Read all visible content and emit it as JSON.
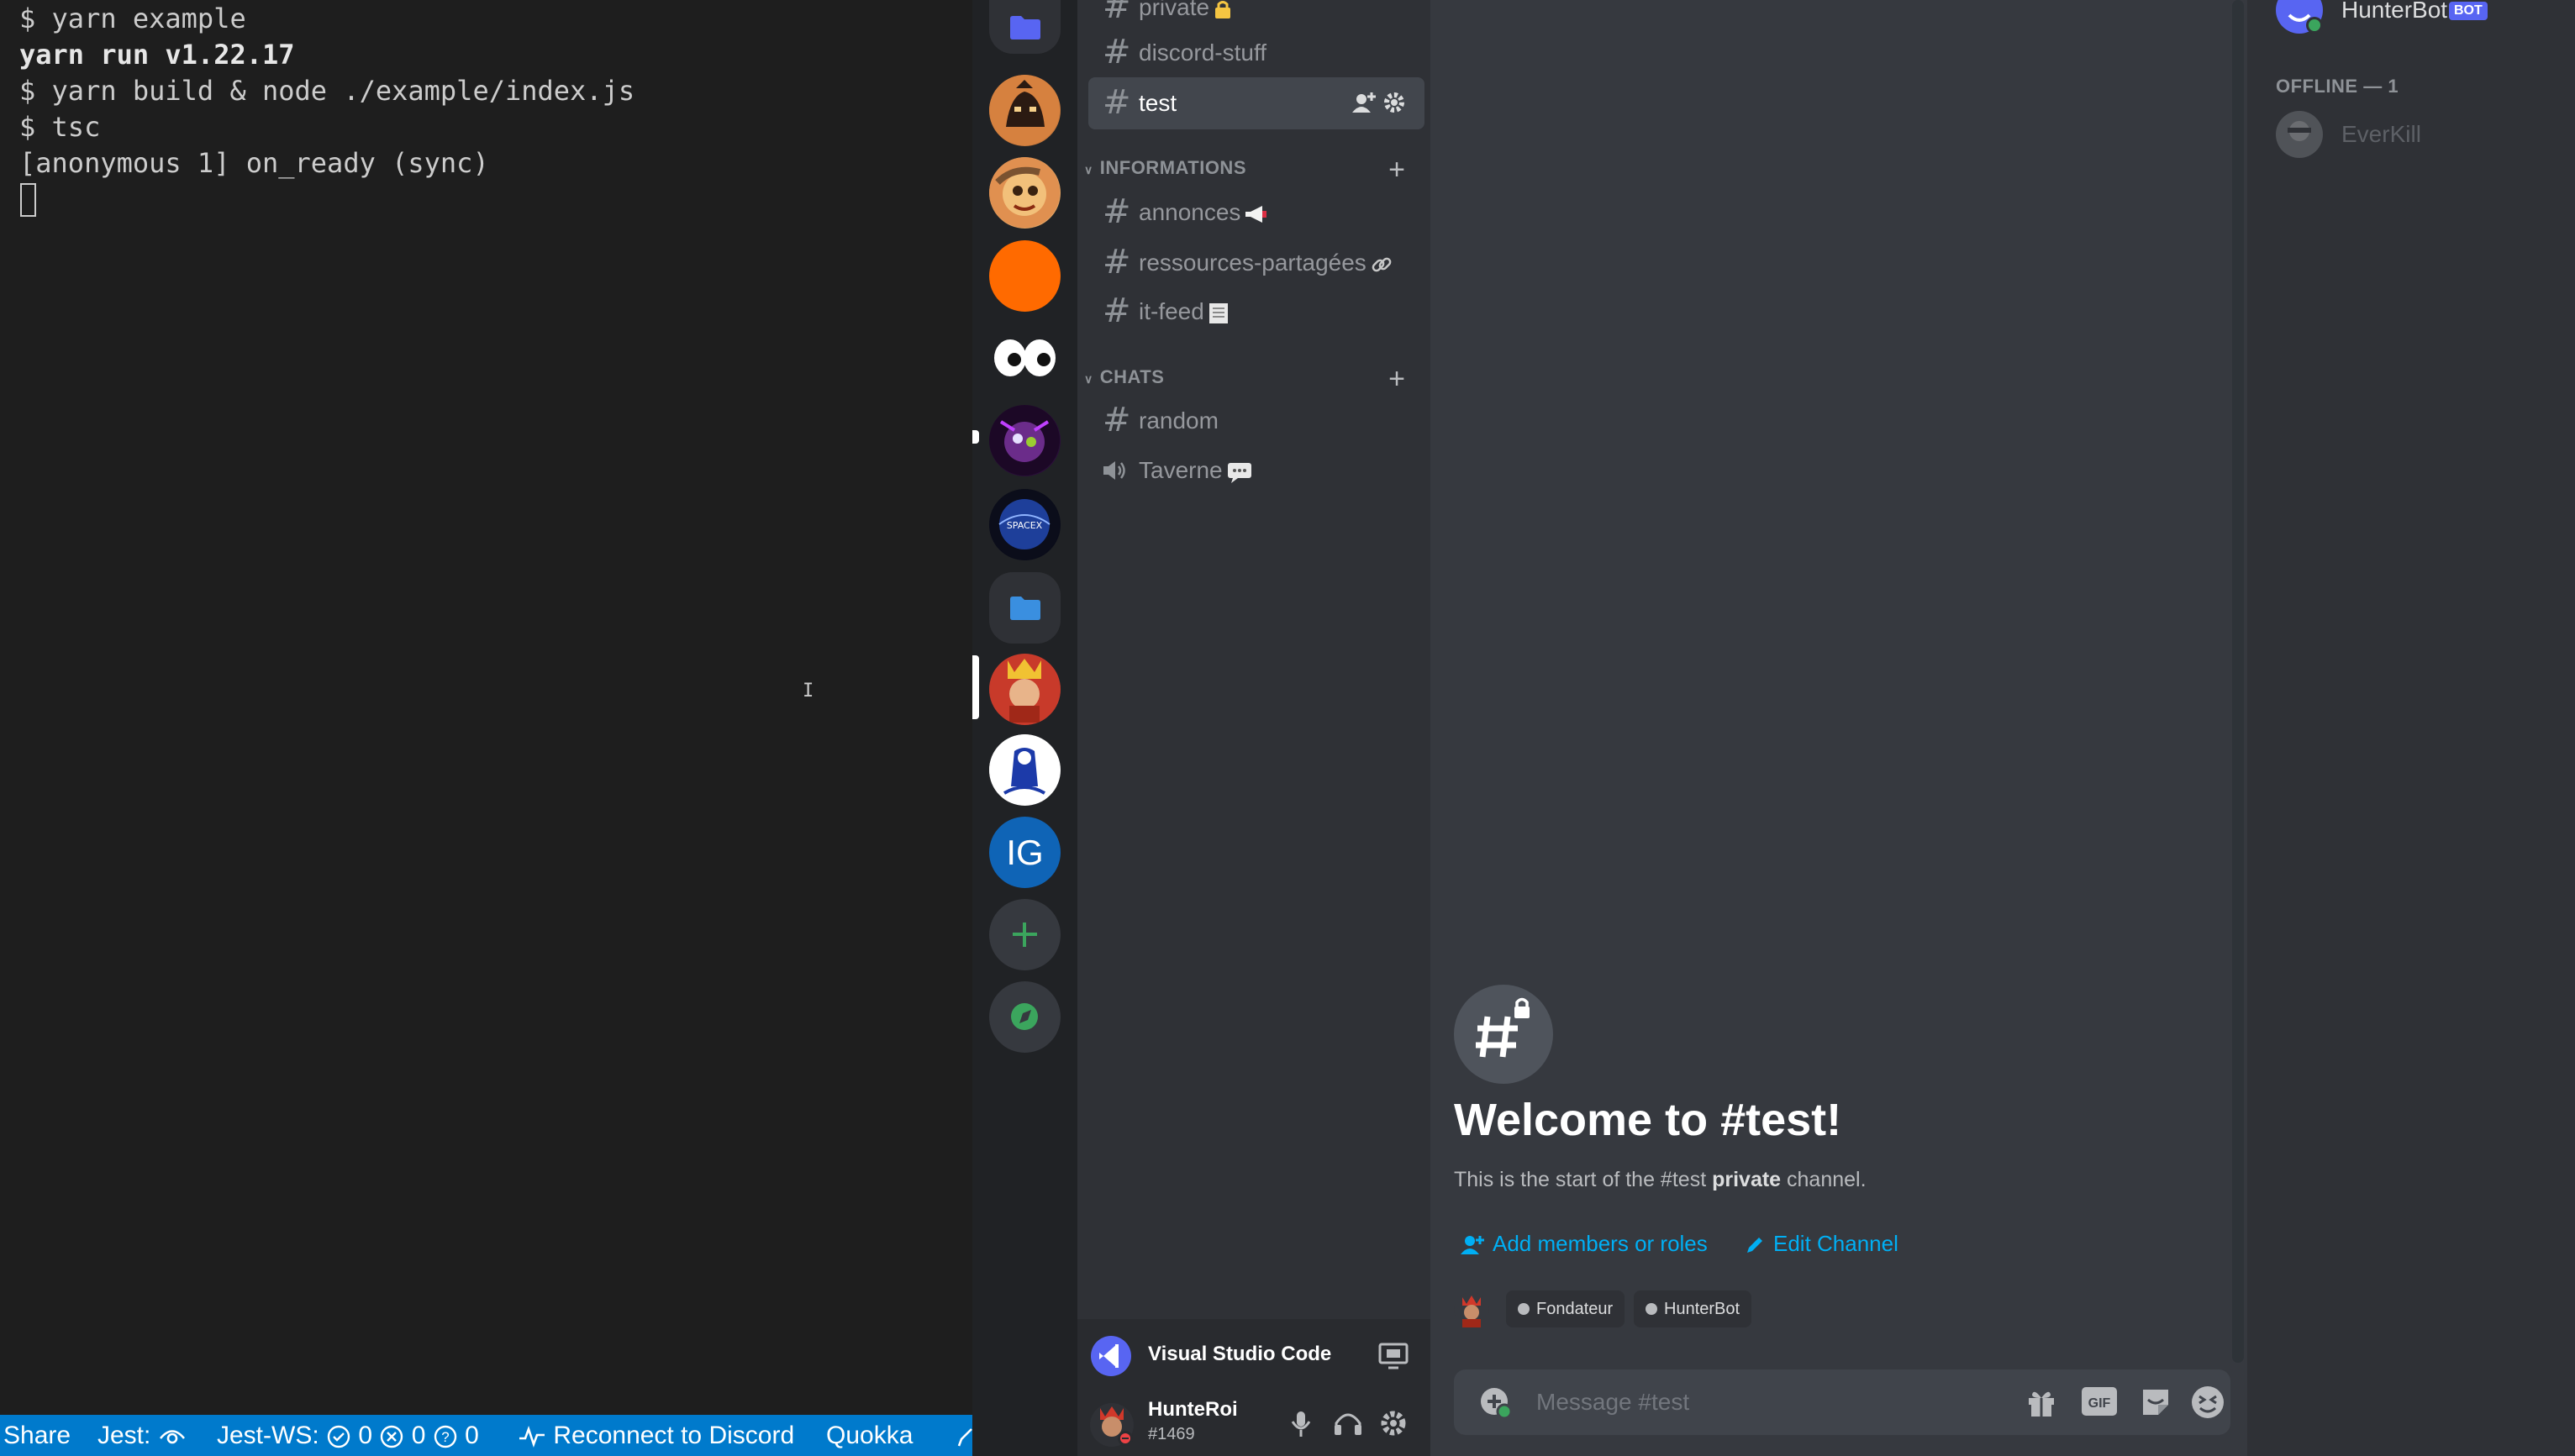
{
  "terminal": {
    "lines": [
      "$ yarn example",
      "yarn run v1.22.17",
      "$ yarn build & node ./example/index.js",
      "$ tsc",
      "[anonymous 1] on_ready (sync)"
    ]
  },
  "statusbar": {
    "share": "Share",
    "jest": "Jest:",
    "jest_ws": "Jest-WS:",
    "pass_count": "0",
    "fail_count": "0",
    "unknown_count": "0",
    "reconnect": "Reconnect to Discord",
    "quokka": "Quokka",
    "color": "#007acc"
  },
  "servers": {
    "ig_initials": "IG",
    "spacex_label": "SPACEX",
    "add_icon": "plus-icon",
    "explore_icon": "compass-icon"
  },
  "channels": {
    "private": "private",
    "discord_stuff": "discord-stuff",
    "test": "test",
    "cat_informations": "INFORMATIONS",
    "annonces": "annonces",
    "ressources": "ressources-partagées",
    "itfeed": "it-feed",
    "cat_chats": "CHATS",
    "random": "random",
    "taverne": "Taverne"
  },
  "activity": {
    "title": "Visual Studio Code"
  },
  "user": {
    "name": "HunteRoi",
    "tag": "#1469"
  },
  "chat": {
    "title": "Welcome to #test!",
    "desc_prefix": "This is the start of the #test ",
    "desc_bold": "private",
    "desc_suffix": " channel.",
    "add_members": "Add members or roles",
    "edit_channel": "Edit Channel",
    "role_1": "Fondateur",
    "role_2": "HunterBot",
    "placeholder": "Message #test",
    "gif": "GIF",
    "link_color": "#00aff4"
  },
  "members": {
    "bot_name": "HunterBot",
    "bot_badge": "BOT",
    "offline_header": "OFFLINE — 1",
    "offline_member": "EverKill"
  }
}
